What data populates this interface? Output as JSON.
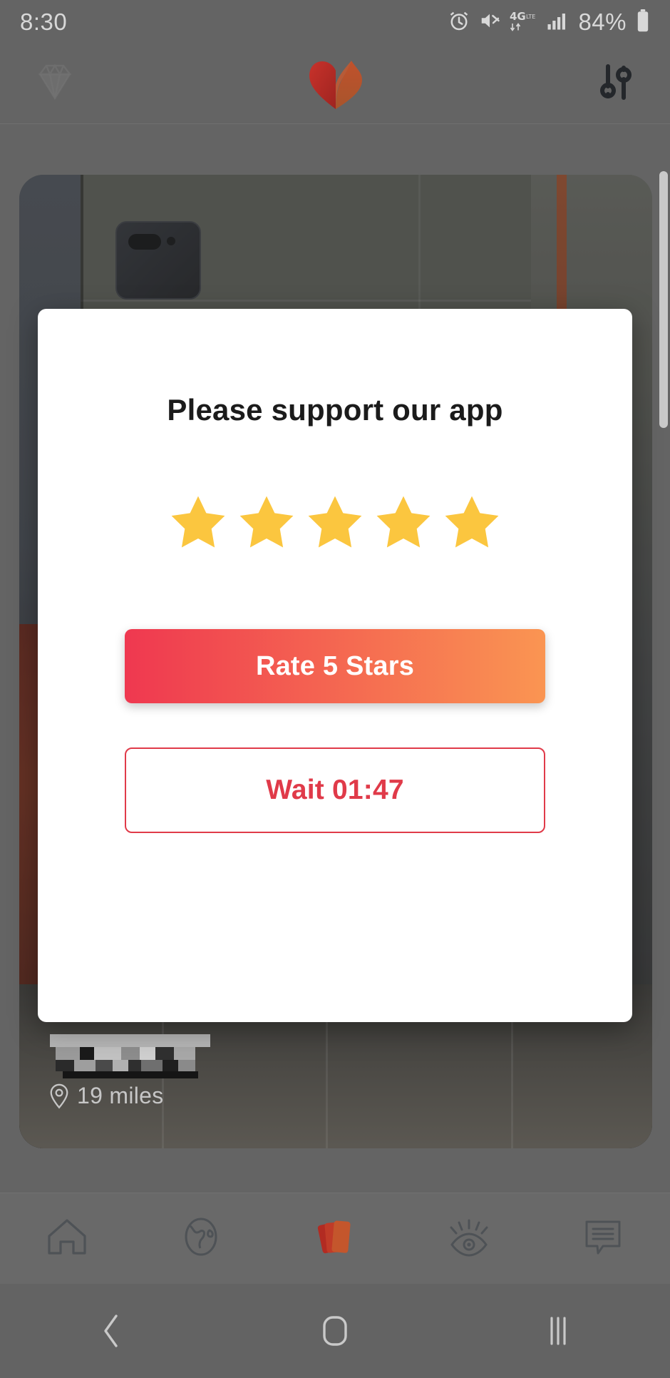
{
  "status_bar": {
    "time": "8:30",
    "battery_percent": "84%",
    "icons": [
      "alarm-icon",
      "mute-icon",
      "4g-lte-icon",
      "signal-bars-icon",
      "battery-icon"
    ]
  },
  "app_header": {
    "left_icon": "diamond-icon",
    "logo_icon": "heart-logo-icon",
    "right_icon": "filter-sliders-icon"
  },
  "profile_card": {
    "name_censored": "",
    "distance": "19 miles",
    "distance_icon": "location-pin-icon"
  },
  "dialog": {
    "title": "Please support our app",
    "stars": {
      "count": 5,
      "filled": 5,
      "color": "#FBC63F"
    },
    "primary_button": {
      "label": "Rate 5 Stars",
      "gradient_from": "#EF3850",
      "gradient_to": "#FA9552",
      "text_color": "#FFFFFF"
    },
    "secondary_button": {
      "label": "Wait 01:47",
      "border_color": "#E03A49",
      "text_color": "#E03A49",
      "background": "#FFFFFF"
    }
  },
  "bottom_nav": {
    "items": [
      {
        "name": "home",
        "icon": "home-icon",
        "active": false
      },
      {
        "name": "explore",
        "icon": "globe-icon",
        "active": false
      },
      {
        "name": "cards",
        "icon": "cards-stack-icon",
        "active": true
      },
      {
        "name": "views",
        "icon": "eye-icon",
        "active": false
      },
      {
        "name": "messages",
        "icon": "chat-bubble-icon",
        "active": false
      }
    ],
    "active_color": "#C0392B",
    "inactive_color": "#4e5256"
  },
  "android_nav": {
    "back": "back-chevron-icon",
    "home": "home-square-icon",
    "recents": "recents-bars-icon"
  },
  "colors": {
    "overlay_grey": "#646464",
    "dialog_bg": "#FFFFFF",
    "title_text": "#1B1B1B"
  }
}
